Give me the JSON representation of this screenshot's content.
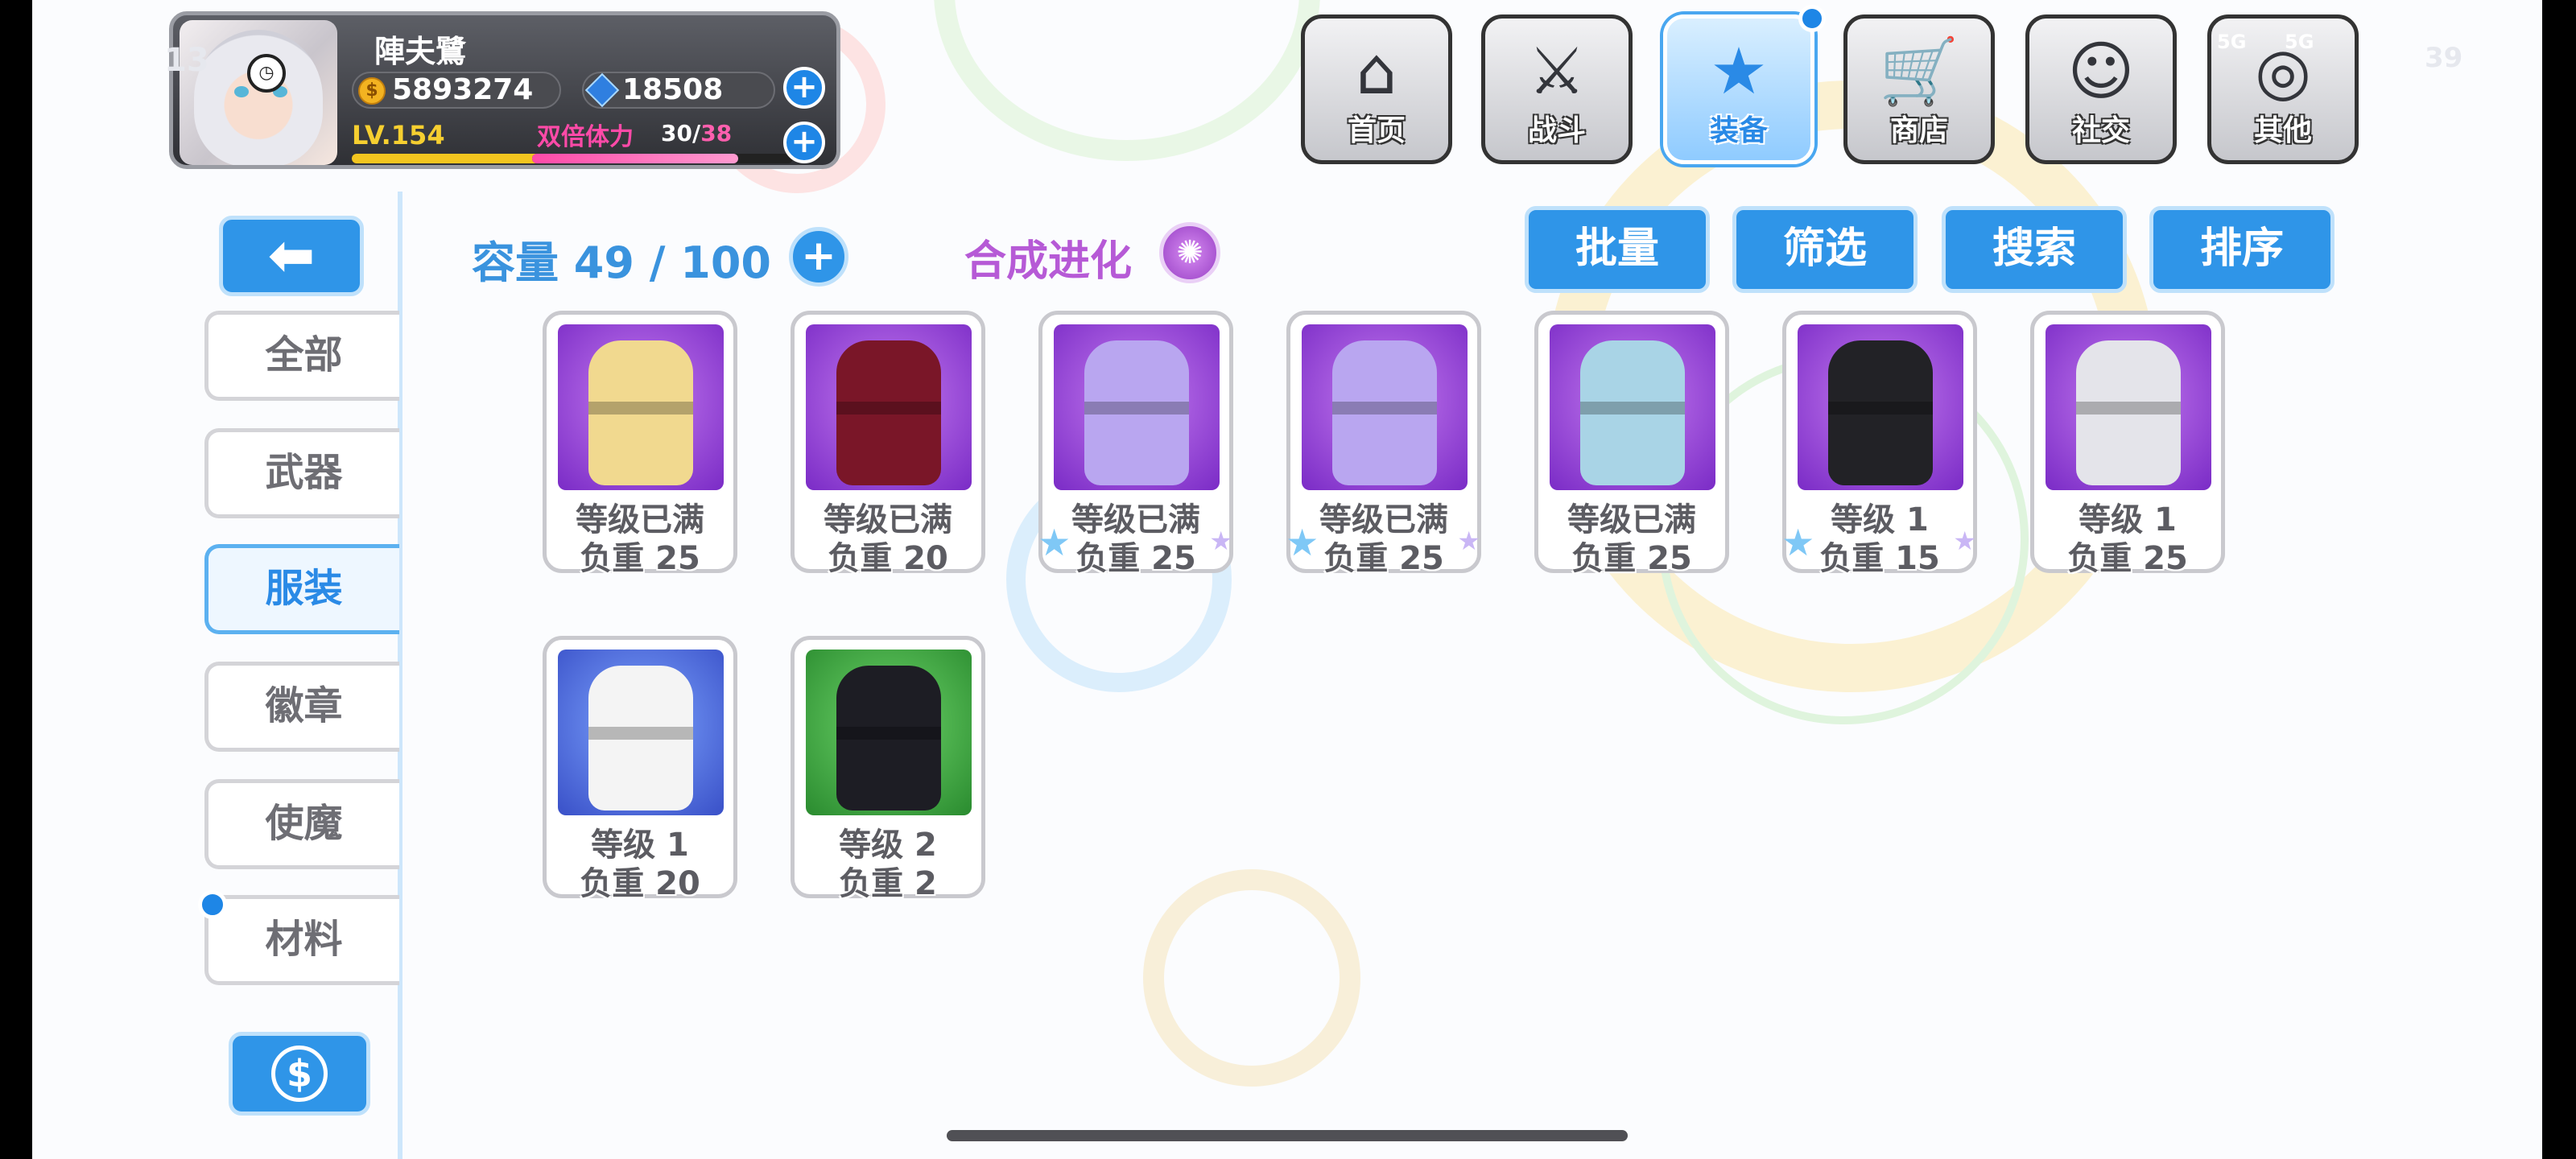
{
  "player": {
    "name": "陣夫鷺",
    "gold": "5893274",
    "gems": "18508",
    "level": "LV.154",
    "double_stamina_label": "双倍体力",
    "stamina_current": "30",
    "stamina_max": "38",
    "level_progress": 0.8,
    "stamina_progress": 0.79
  },
  "status_bar": {
    "left_time_fragment": "13",
    "right_battery": "39",
    "signal_label_1": "5G",
    "signal_label_2": "5G"
  },
  "nav": [
    {
      "label": "首页",
      "icon": "house-icon",
      "glyph": "⌂"
    },
    {
      "label": "战斗",
      "icon": "swords-icon",
      "glyph": "⚔"
    },
    {
      "label": "装备",
      "icon": "star-gun-icon",
      "glyph": "★"
    },
    {
      "label": "商店",
      "icon": "shop-basket-icon",
      "glyph": "🛒"
    },
    {
      "label": "社交",
      "icon": "ghost-social-icon",
      "glyph": "☺"
    },
    {
      "label": "其他",
      "icon": "target-icon",
      "glyph": "◎"
    }
  ],
  "categories": [
    "全部",
    "武器",
    "服装",
    "徽章",
    "使魔",
    "材料"
  ],
  "active_category": "服装",
  "capacity": {
    "label": "容量",
    "current": "49",
    "max": "100",
    "text": "容量 49 / 100"
  },
  "synthesis_label": "合成进化",
  "actions": [
    "批量",
    "筛选",
    "搜索",
    "排序"
  ],
  "items": [
    {
      "line1": "等级已满",
      "line2": "负重 25",
      "bg": "purple",
      "dress": "#f1d98f",
      "starred": false
    },
    {
      "line1": "等级已满",
      "line2": "负重 20",
      "bg": "purple",
      "dress": "#7a1628",
      "starred": false
    },
    {
      "line1": "等级已满",
      "line2": "负重 25",
      "bg": "purple",
      "dress": "#b9a6f0",
      "starred": true
    },
    {
      "line1": "等级已满",
      "line2": "负重 25",
      "bg": "purple",
      "dress": "#b9a6f0",
      "starred": true
    },
    {
      "line1": "等级已满",
      "line2": "负重 25",
      "bg": "purple",
      "dress": "#a9d4e6",
      "starred": false
    },
    {
      "line1": "等级 1",
      "line2": "负重 15",
      "bg": "purple",
      "dress": "#222226",
      "starred": true
    },
    {
      "line1": "等级 1",
      "line2": "负重 25",
      "bg": "purple",
      "dress": "#e4e4ea",
      "starred": false
    },
    {
      "line1": "等级 1",
      "line2": "负重 20",
      "bg": "blue",
      "dress": "#f4f4f4",
      "starred": false
    },
    {
      "line1": "等级 2",
      "line2": "负重 2",
      "bg": "green",
      "dress": "#1d1d24",
      "starred": false
    }
  ],
  "colors": {
    "accent": "#2f95e8",
    "synth": "#b65ad6",
    "gold": "#f3b321",
    "stamina": "#ff4aa8"
  }
}
